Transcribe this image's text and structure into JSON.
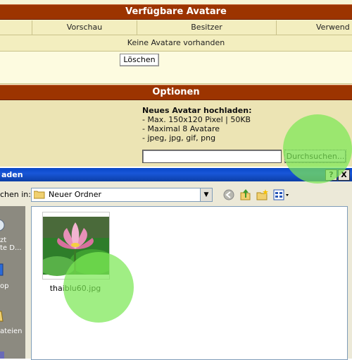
{
  "section_avatars": {
    "title": "Verfügbare Avatare"
  },
  "columns": [
    "Vorschau",
    "Besitzer",
    "Verwend"
  ],
  "empty_message": "Keine Avatare vorhanden",
  "delete_button": "Löschen",
  "section_options": {
    "title": "Optionen"
  },
  "upload": {
    "title": "Neues Avatar hochladen:",
    "rules": [
      "- Max. 150x120 Pixel | 50KB",
      "- Maximal 8 Avatare",
      "- jpeg, jpg, gif, png"
    ],
    "browse_button": "Durchsuchen...",
    "file_value": ""
  },
  "dialog": {
    "title_partial": "aden",
    "help_button": "?",
    "close_button": "X",
    "look_in_label": "chen in:",
    "look_in_value": "Neuer Ordner",
    "places": [
      "zt",
      "te D...",
      "op",
      "ateien"
    ],
    "files": [
      {
        "name": "thaiblu60.jpg"
      }
    ]
  },
  "colors": {
    "header_bg": "#9c3400",
    "table_bg": "#f3eebf",
    "options_bg": "#ece4b4",
    "dialog_title": "#0a48c8",
    "dialog_body": "#ece9d8",
    "click_highlight": "#7ce854"
  }
}
